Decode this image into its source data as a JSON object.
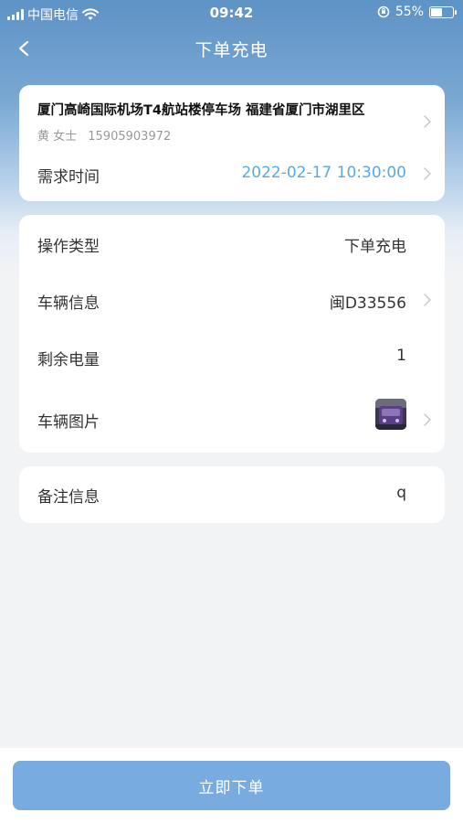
{
  "status_bar": {
    "carrier": "中国电信",
    "time": "09:42",
    "battery_text": "55%",
    "battery_level": 0.55
  },
  "nav": {
    "title": "下单充电"
  },
  "location_card": {
    "address": "厦门高崎国际机场T4航站楼停车场   福建省厦门市湖里区",
    "contact_name": "黄   女士",
    "contact_phone": "15905903972",
    "time_label": "需求时间",
    "time_value": "2022-02-17 10:30:00"
  },
  "details_card": {
    "operation_label": "操作类型",
    "operation_value": "下单充电",
    "vehicle_label": "车辆信息",
    "vehicle_value": "闽D33556",
    "battery_label": "剩余电量",
    "battery_value": "1",
    "photo_label": "车辆图片"
  },
  "notes_card": {
    "label": "备注信息",
    "value": "q"
  },
  "footer": {
    "submit_label": "立即下单"
  },
  "colors": {
    "header_gradient_top": "#5e93c6",
    "accent_blue": "#5aa9e6",
    "button": "#78abe0"
  }
}
